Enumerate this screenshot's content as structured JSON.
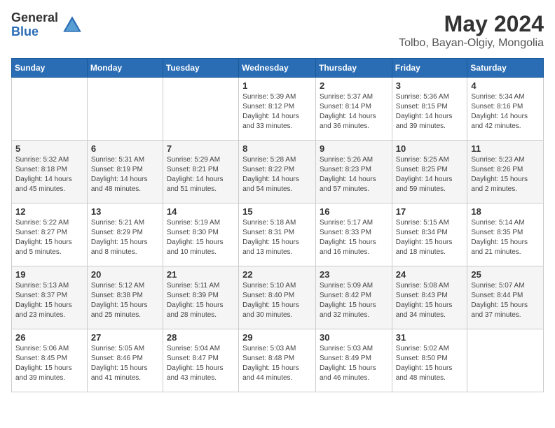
{
  "logo": {
    "general": "General",
    "blue": "Blue"
  },
  "title": "May 2024",
  "location": "Tolbo, Bayan-Olgiy, Mongolia",
  "days_header": [
    "Sunday",
    "Monday",
    "Tuesday",
    "Wednesday",
    "Thursday",
    "Friday",
    "Saturday"
  ],
  "weeks": [
    [
      {
        "day": "",
        "info": ""
      },
      {
        "day": "",
        "info": ""
      },
      {
        "day": "",
        "info": ""
      },
      {
        "day": "1",
        "info": "Sunrise: 5:39 AM\nSunset: 8:12 PM\nDaylight: 14 hours\nand 33 minutes."
      },
      {
        "day": "2",
        "info": "Sunrise: 5:37 AM\nSunset: 8:14 PM\nDaylight: 14 hours\nand 36 minutes."
      },
      {
        "day": "3",
        "info": "Sunrise: 5:36 AM\nSunset: 8:15 PM\nDaylight: 14 hours\nand 39 minutes."
      },
      {
        "day": "4",
        "info": "Sunrise: 5:34 AM\nSunset: 8:16 PM\nDaylight: 14 hours\nand 42 minutes."
      }
    ],
    [
      {
        "day": "5",
        "info": "Sunrise: 5:32 AM\nSunset: 8:18 PM\nDaylight: 14 hours\nand 45 minutes."
      },
      {
        "day": "6",
        "info": "Sunrise: 5:31 AM\nSunset: 8:19 PM\nDaylight: 14 hours\nand 48 minutes."
      },
      {
        "day": "7",
        "info": "Sunrise: 5:29 AM\nSunset: 8:21 PM\nDaylight: 14 hours\nand 51 minutes."
      },
      {
        "day": "8",
        "info": "Sunrise: 5:28 AM\nSunset: 8:22 PM\nDaylight: 14 hours\nand 54 minutes."
      },
      {
        "day": "9",
        "info": "Sunrise: 5:26 AM\nSunset: 8:23 PM\nDaylight: 14 hours\nand 57 minutes."
      },
      {
        "day": "10",
        "info": "Sunrise: 5:25 AM\nSunset: 8:25 PM\nDaylight: 14 hours\nand 59 minutes."
      },
      {
        "day": "11",
        "info": "Sunrise: 5:23 AM\nSunset: 8:26 PM\nDaylight: 15 hours\nand 2 minutes."
      }
    ],
    [
      {
        "day": "12",
        "info": "Sunrise: 5:22 AM\nSunset: 8:27 PM\nDaylight: 15 hours\nand 5 minutes."
      },
      {
        "day": "13",
        "info": "Sunrise: 5:21 AM\nSunset: 8:29 PM\nDaylight: 15 hours\nand 8 minutes."
      },
      {
        "day": "14",
        "info": "Sunrise: 5:19 AM\nSunset: 8:30 PM\nDaylight: 15 hours\nand 10 minutes."
      },
      {
        "day": "15",
        "info": "Sunrise: 5:18 AM\nSunset: 8:31 PM\nDaylight: 15 hours\nand 13 minutes."
      },
      {
        "day": "16",
        "info": "Sunrise: 5:17 AM\nSunset: 8:33 PM\nDaylight: 15 hours\nand 16 minutes."
      },
      {
        "day": "17",
        "info": "Sunrise: 5:15 AM\nSunset: 8:34 PM\nDaylight: 15 hours\nand 18 minutes."
      },
      {
        "day": "18",
        "info": "Sunrise: 5:14 AM\nSunset: 8:35 PM\nDaylight: 15 hours\nand 21 minutes."
      }
    ],
    [
      {
        "day": "19",
        "info": "Sunrise: 5:13 AM\nSunset: 8:37 PM\nDaylight: 15 hours\nand 23 minutes."
      },
      {
        "day": "20",
        "info": "Sunrise: 5:12 AM\nSunset: 8:38 PM\nDaylight: 15 hours\nand 25 minutes."
      },
      {
        "day": "21",
        "info": "Sunrise: 5:11 AM\nSunset: 8:39 PM\nDaylight: 15 hours\nand 28 minutes."
      },
      {
        "day": "22",
        "info": "Sunrise: 5:10 AM\nSunset: 8:40 PM\nDaylight: 15 hours\nand 30 minutes."
      },
      {
        "day": "23",
        "info": "Sunrise: 5:09 AM\nSunset: 8:42 PM\nDaylight: 15 hours\nand 32 minutes."
      },
      {
        "day": "24",
        "info": "Sunrise: 5:08 AM\nSunset: 8:43 PM\nDaylight: 15 hours\nand 34 minutes."
      },
      {
        "day": "25",
        "info": "Sunrise: 5:07 AM\nSunset: 8:44 PM\nDaylight: 15 hours\nand 37 minutes."
      }
    ],
    [
      {
        "day": "26",
        "info": "Sunrise: 5:06 AM\nSunset: 8:45 PM\nDaylight: 15 hours\nand 39 minutes."
      },
      {
        "day": "27",
        "info": "Sunrise: 5:05 AM\nSunset: 8:46 PM\nDaylight: 15 hours\nand 41 minutes."
      },
      {
        "day": "28",
        "info": "Sunrise: 5:04 AM\nSunset: 8:47 PM\nDaylight: 15 hours\nand 43 minutes."
      },
      {
        "day": "29",
        "info": "Sunrise: 5:03 AM\nSunset: 8:48 PM\nDaylight: 15 hours\nand 44 minutes."
      },
      {
        "day": "30",
        "info": "Sunrise: 5:03 AM\nSunset: 8:49 PM\nDaylight: 15 hours\nand 46 minutes."
      },
      {
        "day": "31",
        "info": "Sunrise: 5:02 AM\nSunset: 8:50 PM\nDaylight: 15 hours\nand 48 minutes."
      },
      {
        "day": "",
        "info": ""
      }
    ]
  ]
}
